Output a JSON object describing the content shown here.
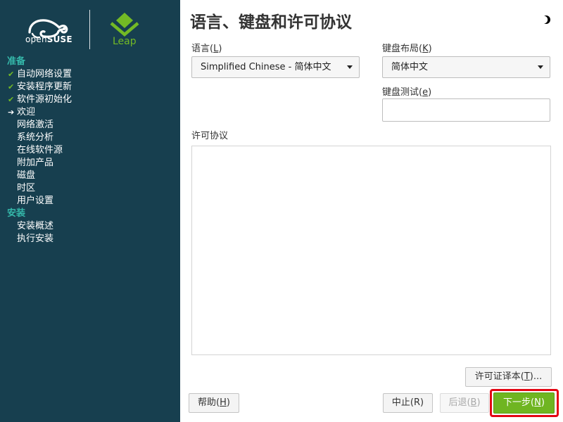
{
  "branding": {
    "opensuse_prefix": "open",
    "opensuse_suffix": "SUSE",
    "product": "Leap",
    "brand_green": "#73ba25",
    "sidebar_bg": "#173f4f",
    "group_color": "#35b9ab"
  },
  "sidebar": {
    "groups": [
      {
        "label": "准备",
        "steps": [
          {
            "label": "自动网络设置",
            "state": "done"
          },
          {
            "label": "安装程序更新",
            "state": "done"
          },
          {
            "label": "软件源初始化",
            "state": "done"
          },
          {
            "label": "欢迎",
            "state": "current"
          },
          {
            "label": "网络激活",
            "state": "todo"
          },
          {
            "label": "系统分析",
            "state": "todo"
          },
          {
            "label": "在线软件源",
            "state": "todo"
          },
          {
            "label": "附加产品",
            "state": "todo"
          },
          {
            "label": "磁盘",
            "state": "todo"
          },
          {
            "label": "时区",
            "state": "todo"
          },
          {
            "label": "用户设置",
            "state": "todo"
          }
        ]
      },
      {
        "label": "安装",
        "steps": [
          {
            "label": "安装概述",
            "state": "todo"
          },
          {
            "label": "执行安装",
            "state": "todo"
          }
        ]
      }
    ]
  },
  "main": {
    "title": "语言、键盘和许可协议",
    "language": {
      "label": "语言(",
      "hotkey": "L",
      "label_end": ")",
      "value": "Simplified Chinese - 简体中文"
    },
    "keyboard": {
      "label": "键盘布局(",
      "hotkey": "K",
      "label_end": ")",
      "value": "简体中文"
    },
    "keyboard_test": {
      "label": "键盘测试(",
      "hotkey": "e",
      "label_end": ")",
      "value": ""
    },
    "license": {
      "label": "许可协议",
      "text": ""
    },
    "translations_button": {
      "label": "许可证译本(",
      "hotkey": "T",
      "label_end": ")..."
    }
  },
  "footer": {
    "help": {
      "label": "帮助(",
      "hotkey": "H",
      "label_end": ")"
    },
    "abort": {
      "label": "中止(R)"
    },
    "back": {
      "label": "后退(",
      "hotkey": "B",
      "label_end": ")"
    },
    "next": {
      "label": "下一步(",
      "hotkey": "N",
      "label_end": ")"
    },
    "highlight_color": "#e30613"
  }
}
